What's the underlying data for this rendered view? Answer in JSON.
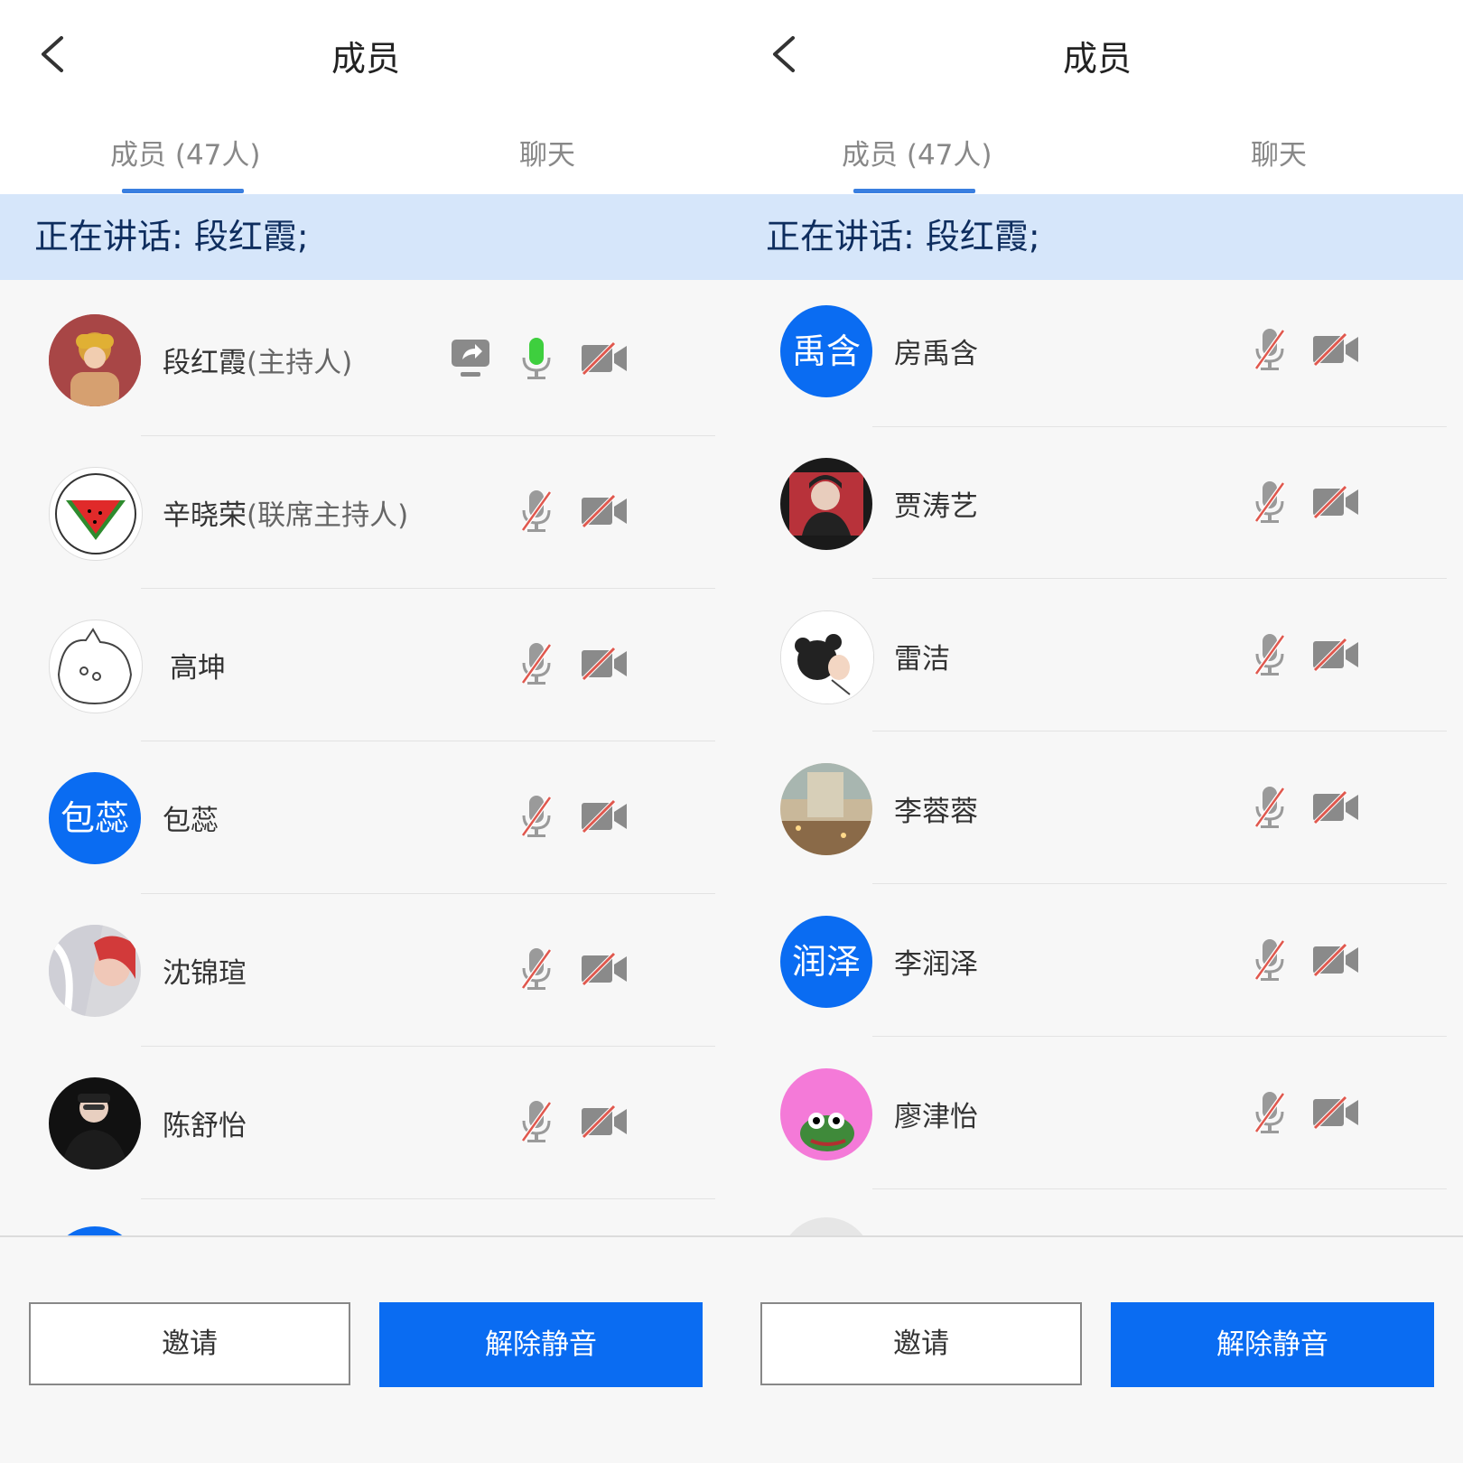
{
  "left": {
    "title": "成员",
    "tabs": [
      "成员 (47人)",
      "聊天"
    ],
    "speaking": "正在讲话: 段红霞;",
    "members": [
      {
        "name": "段红霞",
        "role": "(主持人)",
        "avatar_text": "",
        "share_icon": "share-screen-icon",
        "mic": "mic-active-icon",
        "cam": "camera-off-icon"
      },
      {
        "name": "辛晓荣",
        "role": "(联席主持人)",
        "avatar_text": "",
        "mic": "mic-muted-icon",
        "cam": "camera-off-icon"
      },
      {
        "name": "高坤",
        "role": "",
        "avatar_text": "",
        "mic": "mic-muted-icon",
        "cam": "camera-off-icon"
      },
      {
        "name": "包蕊",
        "role": "",
        "avatar_text": "包蕊",
        "mic": "mic-muted-icon",
        "cam": "camera-off-icon"
      },
      {
        "name": "沈锦瑄",
        "role": "",
        "avatar_text": "",
        "mic": "mic-muted-icon",
        "cam": "camera-off-icon"
      },
      {
        "name": "陈舒怡",
        "role": "",
        "avatar_text": "",
        "mic": "mic-muted-icon",
        "cam": "camera-off-icon"
      }
    ],
    "buttons": {
      "invite": "邀请",
      "unmute": "解除静音"
    }
  },
  "right": {
    "title": "成员",
    "tabs": [
      "成员 (47人)",
      "聊天"
    ],
    "speaking": "正在讲话: 段红霞;",
    "members": [
      {
        "name": "房禹含",
        "avatar_text": "禹含",
        "mic": "mic-muted-icon",
        "cam": "camera-off-icon"
      },
      {
        "name": "贾涛艺",
        "avatar_text": "",
        "mic": "mic-muted-icon",
        "cam": "camera-off-icon"
      },
      {
        "name": "雷洁",
        "avatar_text": "",
        "mic": "mic-muted-icon",
        "cam": "camera-off-icon"
      },
      {
        "name": "李蓉蓉",
        "avatar_text": "",
        "mic": "mic-muted-icon",
        "cam": "camera-off-icon"
      },
      {
        "name": "李润泽",
        "avatar_text": "润泽",
        "mic": "mic-muted-icon",
        "cam": "camera-off-icon"
      },
      {
        "name": "廖津怡",
        "avatar_text": "",
        "mic": "mic-muted-icon",
        "cam": "camera-off-icon"
      }
    ],
    "buttons": {
      "invite": "邀请",
      "unmute": "解除静音"
    }
  },
  "colors": {
    "accent": "#0a6cf2",
    "speaking_bg": "#d6e6fa",
    "mic_active": "#3ecf3e",
    "muted_slash": "#e0584e",
    "icon_gray": "#9a9a9a"
  }
}
